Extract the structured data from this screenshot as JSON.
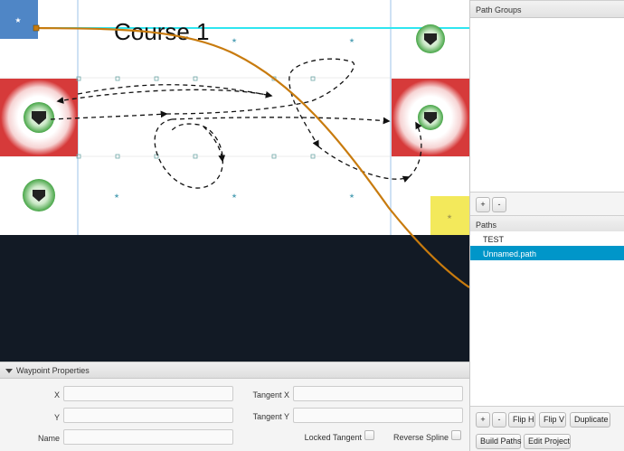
{
  "field": {
    "course_title": "Course 1"
  },
  "path_groups": {
    "header": "Path Groups",
    "add_label": "+",
    "remove_label": "-"
  },
  "paths": {
    "header": "Paths",
    "items": [
      "TEST",
      "Unnamed.path"
    ],
    "selected_index": 1
  },
  "path_buttons": {
    "add": "+",
    "remove": "-",
    "flip_h": "Flip H",
    "flip_v": "Flip V",
    "duplicate": "Duplicate",
    "build_paths": "Build Paths",
    "edit_project": "Edit Project"
  },
  "waypoint_properties": {
    "header": "Waypoint Properties",
    "x_label": "X",
    "y_label": "Y",
    "name_label": "Name",
    "tangent_x_label": "Tangent X",
    "tangent_y_label": "Tangent Y",
    "locked_tangent_label": "Locked Tangent",
    "reverse_spline_label": "Reverse Spline",
    "x_value": "",
    "y_value": "",
    "name_value": "",
    "tangent_x_value": "",
    "tangent_y_value": ""
  },
  "colors": {
    "selection": "#0096c9",
    "path_curve": "#c87b0e",
    "guide_line": "#2fe6f0",
    "start_zone": "#4f86c6",
    "end_zone": "#f3e95b",
    "red_zone": "#d63a3a",
    "dark_area": "#121a25"
  }
}
